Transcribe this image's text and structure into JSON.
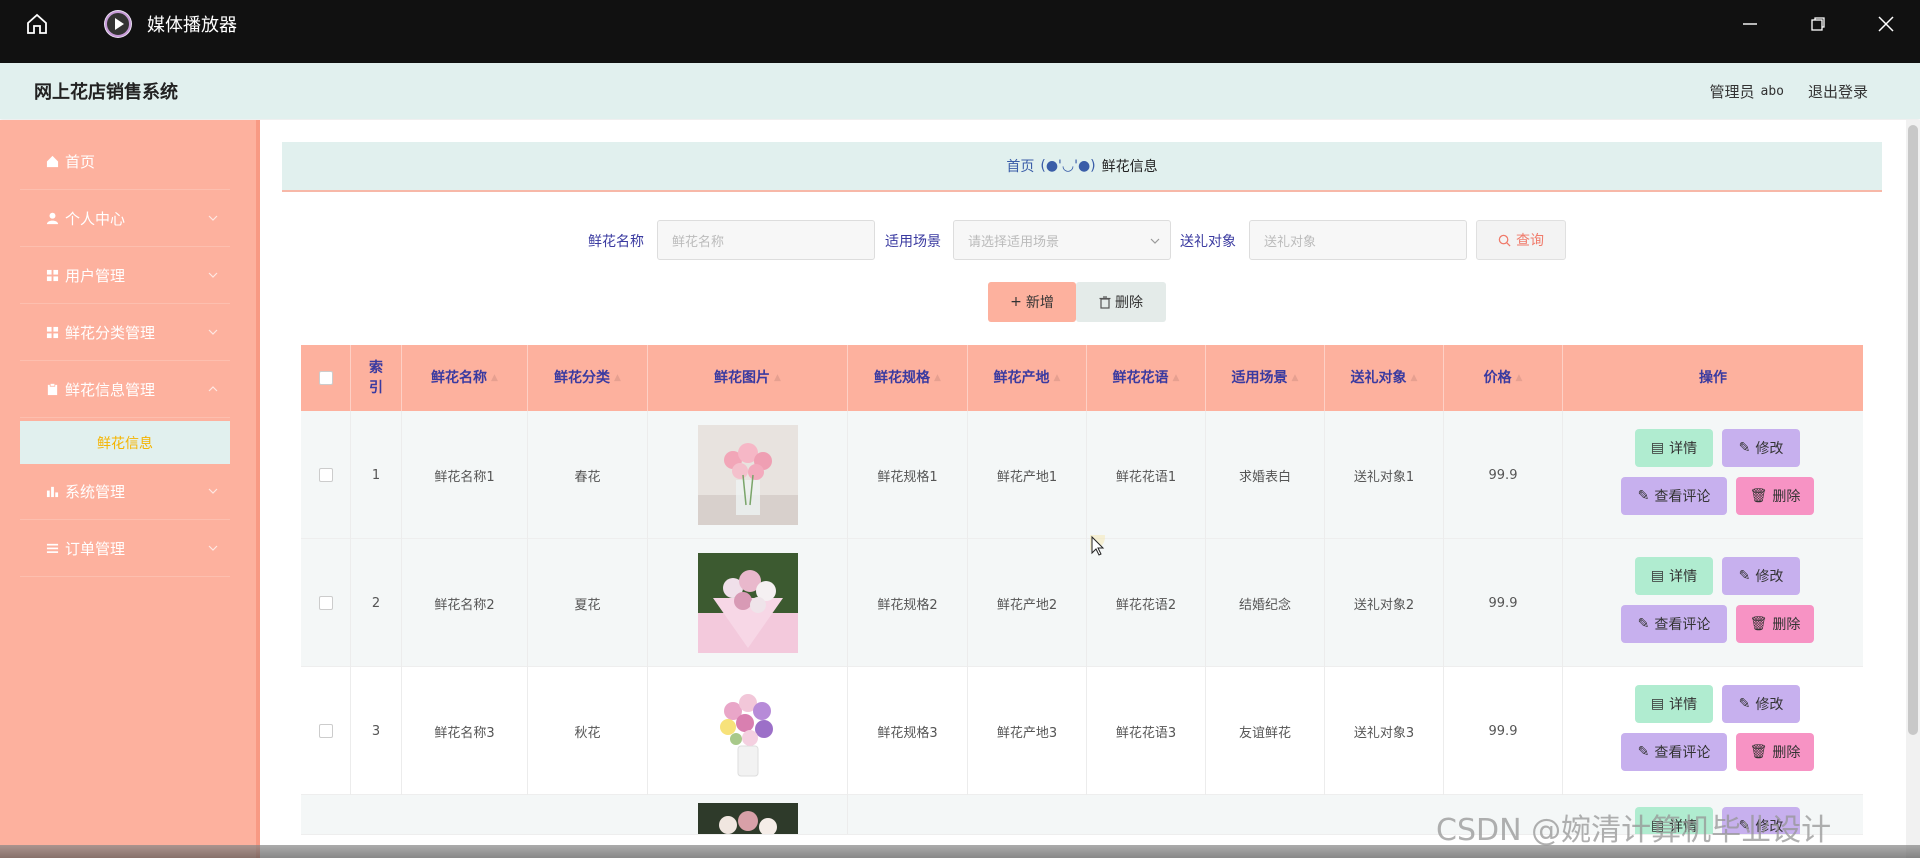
{
  "player": {
    "title": "媒体播放器"
  },
  "header": {
    "title": "网上花店销售系统",
    "role": "管理员",
    "username": "abo",
    "logout": "退出登录"
  },
  "sidebar": {
    "items": [
      {
        "label": "首页",
        "icon": "home-icon"
      },
      {
        "label": "个人中心",
        "icon": "person-icon"
      },
      {
        "label": "用户管理",
        "icon": "grid-icon"
      },
      {
        "label": "鲜花分类管理",
        "icon": "grid-icon"
      },
      {
        "label": "鲜花信息管理",
        "icon": "clipboard-icon"
      },
      {
        "label": "系统管理",
        "icon": "bar-chart-icon"
      },
      {
        "label": "订单管理",
        "icon": "menu-icon"
      }
    ],
    "active_sub": "鲜花信息"
  },
  "breadcrumb": {
    "home": "首页",
    "face": "(●'◡'●)",
    "current": "鲜花信息"
  },
  "search": {
    "name_label": "鲜花名称",
    "name_placeholder": "鲜花名称",
    "scene_label": "适用场景",
    "scene_placeholder": "请选择适用场景",
    "target_label": "送礼对象",
    "target_placeholder": "送礼对象",
    "query": "查询"
  },
  "toolbar": {
    "add": "新增",
    "delete": "删除"
  },
  "table": {
    "headers": [
      "索引",
      "鲜花名称",
      "鲜花分类",
      "鲜花图片",
      "鲜花规格",
      "鲜花产地",
      "鲜花花语",
      "适用场景",
      "送礼对象",
      "价格",
      "操作"
    ],
    "rows": [
      {
        "index": "1",
        "name": "鲜花名称1",
        "category": "春花",
        "spec": "鲜花规格1",
        "origin": "鲜花产地1",
        "language": "鲜花花语1",
        "scene": "求婚表白",
        "target": "送礼对象1",
        "price": "99.9"
      },
      {
        "index": "2",
        "name": "鲜花名称2",
        "category": "夏花",
        "spec": "鲜花规格2",
        "origin": "鲜花产地2",
        "language": "鲜花花语2",
        "scene": "结婚纪念",
        "target": "送礼对象2",
        "price": "99.9"
      },
      {
        "index": "3",
        "name": "鲜花名称3",
        "category": "秋花",
        "spec": "鲜花规格3",
        "origin": "鲜花产地3",
        "language": "鲜花花语3",
        "scene": "友谊鲜花",
        "target": "送礼对象3",
        "price": "99.9"
      }
    ],
    "actions": {
      "detail": "详情",
      "edit": "修改",
      "comment": "查看评论",
      "delete": "删除"
    }
  },
  "watermark": "CSDN @婉清计算机毕业设计",
  "colors": {
    "sidebar": "#fdb19e",
    "header": "#e1f0ee",
    "accent_text": "#3a3aa0",
    "detail_btn": "#b0ecd0",
    "edit_btn": "#c7b0ee",
    "delete_btn": "#f793c4"
  }
}
